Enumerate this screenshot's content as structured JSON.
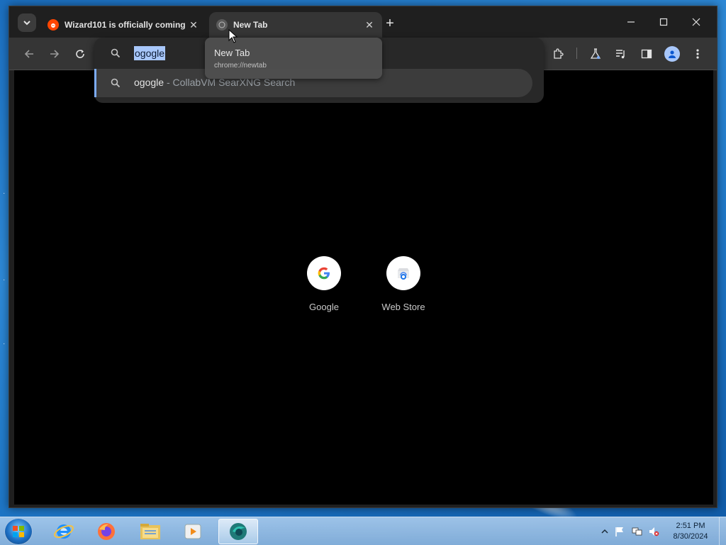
{
  "browser": {
    "tabs": [
      {
        "title": "Wizard101 is officially coming",
        "favicon": "reddit-icon",
        "active": false
      },
      {
        "title": "New Tab",
        "favicon": "globe-icon",
        "active": true
      }
    ],
    "omnibox": {
      "input_value": "ogogle",
      "suggestion": {
        "query": "ogogle",
        "separator": "-",
        "engine": "CollabVM SearXNG Search"
      }
    },
    "hover_card": {
      "title": "New Tab",
      "url": "chrome://newtab"
    },
    "shortcuts": [
      {
        "label": "Google",
        "icon": "google-icon"
      },
      {
        "label": "Web Store",
        "icon": "web-store-icon"
      }
    ]
  },
  "taskbar": {
    "apps": [
      "internet-explorer-icon",
      "firefox-icon",
      "file-explorer-icon",
      "media-player-icon",
      "browser-icon"
    ],
    "clock": {
      "time": "2:51 PM",
      "date": "8/30/2024"
    }
  },
  "colors": {
    "accent": "#a8c7fa",
    "content_bg": "#000000",
    "chrome_bg": "#1f1f1f"
  }
}
